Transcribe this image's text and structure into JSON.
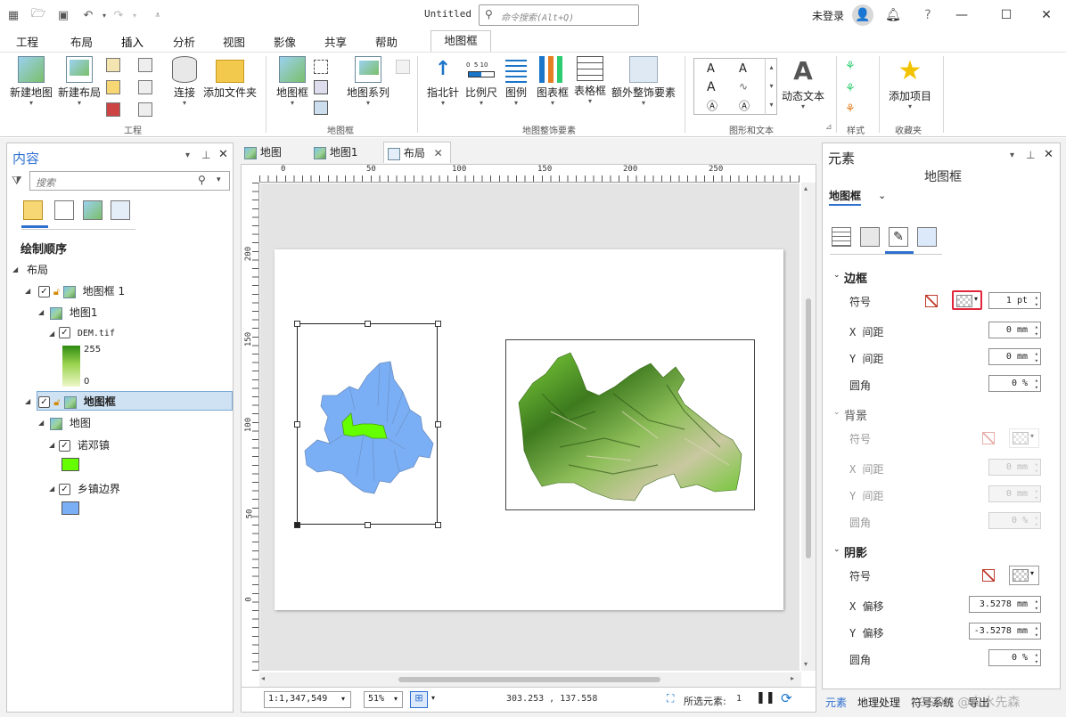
{
  "app": {
    "title": "Untitled",
    "command_search_placeholder": "命令搜索(Alt+Q)",
    "login": "未登录"
  },
  "menu": {
    "tabs": [
      "工程",
      "布局",
      "插入",
      "分析",
      "视图",
      "影像",
      "共享",
      "帮助"
    ],
    "active": "插入",
    "context_tab": "地图框"
  },
  "ribbon": {
    "buttons": {
      "new_map": "新建地图",
      "new_layout": "新建布局",
      "connect": "连接",
      "add_folder": "添加文件夹",
      "map_frame": "地图框",
      "map_series": "地图系列",
      "north_arrow": "指北针",
      "scale_bar": "比例尺",
      "legend": "图例",
      "chart_frame": "图表框",
      "table_frame": "表格框",
      "extra_surround": "额外整饰要素",
      "dynamic_text": "动态文本",
      "add_item": "添加项目"
    },
    "scale_bar_ticks": "0  5 10",
    "groups": {
      "project": "工程",
      "map_frames": "地图框",
      "surround": "地图整饰要素",
      "graphics_text": "图形和文本",
      "styles": "样式",
      "favorites": "收藏夹"
    }
  },
  "contents": {
    "title": "内容",
    "search_placeholder": "搜索",
    "drawing_order": "绘制顺序",
    "tree": {
      "layout": "布局",
      "map_frame_1": "地图框 1",
      "map1": "地图1",
      "dem": "DEM.tif",
      "dem_high": "255",
      "dem_low": "0",
      "map_frame": "地图框",
      "map": "地图",
      "layer_town": "诺邓镇",
      "layer_boundary": "乡镇边界"
    },
    "colors": {
      "town": "#66ff00",
      "boundary": "#7aaef5"
    }
  },
  "doc_tabs": [
    "地图",
    "地图1",
    "布局"
  ],
  "ruler": {
    "top_labels": [
      "0",
      "50",
      "100",
      "150",
      "200",
      "250"
    ],
    "left_labels": [
      "200",
      "150",
      "100",
      "50",
      "0"
    ]
  },
  "status": {
    "scale": "1:1,347,549",
    "zoom": "51%",
    "coords": "303.253 , 137.558",
    "selected_label": "所选元素:",
    "selected_count": "1"
  },
  "element_panel": {
    "title": "元素",
    "subtitle": "地图框",
    "selector": "地图框",
    "border": {
      "title": "边框",
      "symbol_label": "符号",
      "width": "1 pt",
      "x_gap_label": "X 间距",
      "x_gap": "0 mm",
      "y_gap_label": "Y 间距",
      "y_gap": "0 mm",
      "corner_label": "圆角",
      "corner": "0 %"
    },
    "background": {
      "title": "背景",
      "symbol_label": "符号",
      "x_gap_label": "X 间距",
      "x_gap": "0 mm",
      "y_gap_label": "Y 间距",
      "y_gap": "0 mm",
      "corner_label": "圆角",
      "corner": "0 %"
    },
    "shadow": {
      "title": "阴影",
      "symbol_label": "符号",
      "x_off_label": "X 偏移",
      "x_off": "3.5278 mm",
      "y_off_label": "Y 偏移",
      "y_off": "-3.5278 mm",
      "corner_label": "圆角",
      "corner": "0 %"
    }
  },
  "bottom_tabs": [
    "元素",
    "地理处理",
    "符号系统",
    "导出"
  ],
  "watermark": "CSDN @白水先森"
}
